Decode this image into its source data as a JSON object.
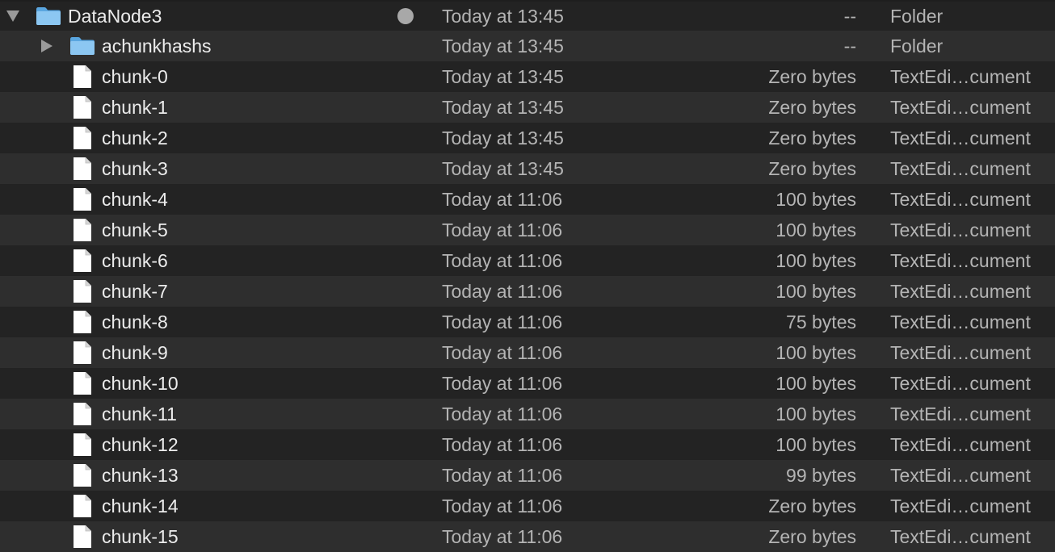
{
  "finder": {
    "rows": [
      {
        "kind_type": "folder",
        "level": 0,
        "expanded": true,
        "has_tag": true,
        "name": "DataNode3",
        "date": "Today at 13:45",
        "size": "--",
        "kind": "Folder"
      },
      {
        "kind_type": "folder",
        "level": 1,
        "expanded": false,
        "has_tag": false,
        "name": "achunkhashs",
        "date": "Today at 13:45",
        "size": "--",
        "kind": "Folder"
      },
      {
        "kind_type": "file",
        "level": 1,
        "name": "chunk-0",
        "date": "Today at 13:45",
        "size": "Zero bytes",
        "kind": "TextEdi…cument"
      },
      {
        "kind_type": "file",
        "level": 1,
        "name": "chunk-1",
        "date": "Today at 13:45",
        "size": "Zero bytes",
        "kind": "TextEdi…cument"
      },
      {
        "kind_type": "file",
        "level": 1,
        "name": "chunk-2",
        "date": "Today at 13:45",
        "size": "Zero bytes",
        "kind": "TextEdi…cument"
      },
      {
        "kind_type": "file",
        "level": 1,
        "name": "chunk-3",
        "date": "Today at 13:45",
        "size": "Zero bytes",
        "kind": "TextEdi…cument"
      },
      {
        "kind_type": "file",
        "level": 1,
        "name": "chunk-4",
        "date": "Today at 11:06",
        "size": "100 bytes",
        "kind": "TextEdi…cument"
      },
      {
        "kind_type": "file",
        "level": 1,
        "name": "chunk-5",
        "date": "Today at 11:06",
        "size": "100 bytes",
        "kind": "TextEdi…cument"
      },
      {
        "kind_type": "file",
        "level": 1,
        "name": "chunk-6",
        "date": "Today at 11:06",
        "size": "100 bytes",
        "kind": "TextEdi…cument"
      },
      {
        "kind_type": "file",
        "level": 1,
        "name": "chunk-7",
        "date": "Today at 11:06",
        "size": "100 bytes",
        "kind": "TextEdi…cument"
      },
      {
        "kind_type": "file",
        "level": 1,
        "name": "chunk-8",
        "date": "Today at 11:06",
        "size": "75 bytes",
        "kind": "TextEdi…cument"
      },
      {
        "kind_type": "file",
        "level": 1,
        "name": "chunk-9",
        "date": "Today at 11:06",
        "size": "100 bytes",
        "kind": "TextEdi…cument"
      },
      {
        "kind_type": "file",
        "level": 1,
        "name": "chunk-10",
        "date": "Today at 11:06",
        "size": "100 bytes",
        "kind": "TextEdi…cument"
      },
      {
        "kind_type": "file",
        "level": 1,
        "name": "chunk-11",
        "date": "Today at 11:06",
        "size": "100 bytes",
        "kind": "TextEdi…cument"
      },
      {
        "kind_type": "file",
        "level": 1,
        "name": "chunk-12",
        "date": "Today at 11:06",
        "size": "100 bytes",
        "kind": "TextEdi…cument"
      },
      {
        "kind_type": "file",
        "level": 1,
        "name": "chunk-13",
        "date": "Today at 11:06",
        "size": "99 bytes",
        "kind": "TextEdi…cument"
      },
      {
        "kind_type": "file",
        "level": 1,
        "name": "chunk-14",
        "date": "Today at 11:06",
        "size": "Zero bytes",
        "kind": "TextEdi…cument"
      },
      {
        "kind_type": "file",
        "level": 1,
        "name": "chunk-15",
        "date": "Today at 11:06",
        "size": "Zero bytes",
        "kind": "TextEdi…cument"
      }
    ]
  },
  "colors": {
    "folder_light": "#8cc7f2",
    "folder_dark": "#5aa6e0",
    "file_page": "#ffffff",
    "tag_gray": "#a8a8a8"
  }
}
